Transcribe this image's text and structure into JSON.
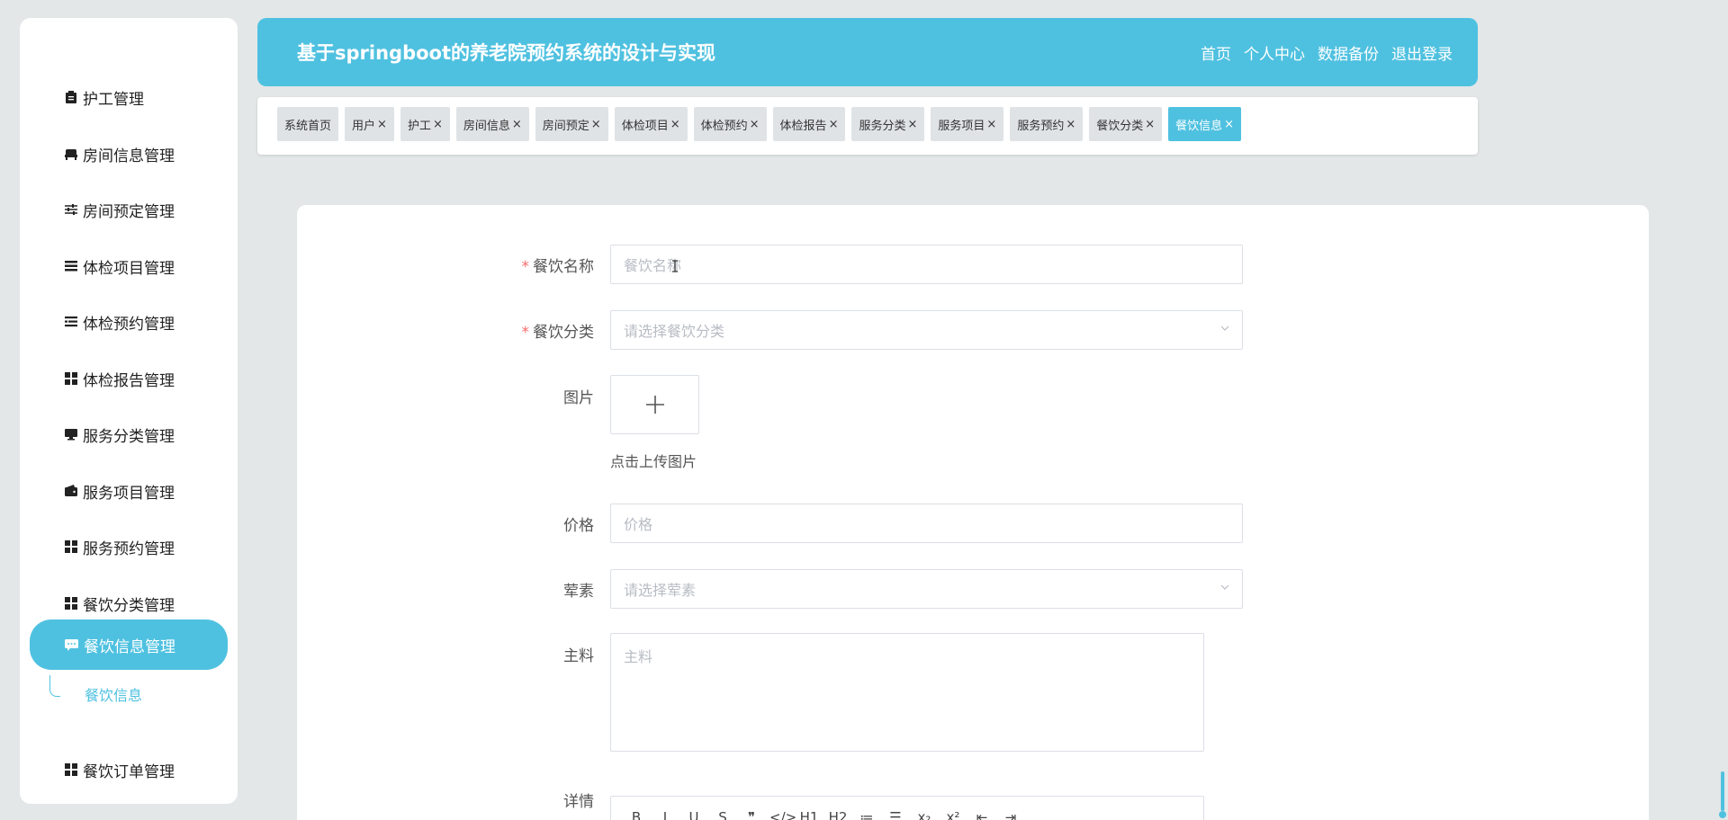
{
  "app": {
    "title": "基于springboot的养老院预约系统的设计与实现",
    "accent_color": "#4fc1e0",
    "nav": [
      "首页",
      "个人中心",
      "数据备份",
      "退出登录"
    ]
  },
  "sidebar": {
    "items": [
      {
        "label": "护工管理",
        "icon": "clipboard-icon"
      },
      {
        "label": "房间信息管理",
        "icon": "bed-icon"
      },
      {
        "label": "房间预定管理",
        "icon": "sliders-icon"
      },
      {
        "label": "体检项目管理",
        "icon": "list-icon"
      },
      {
        "label": "体检预约管理",
        "icon": "list-detail-icon"
      },
      {
        "label": "体检报告管理",
        "icon": "grid-icon"
      },
      {
        "label": "服务分类管理",
        "icon": "monitor-icon"
      },
      {
        "label": "服务项目管理",
        "icon": "wallet-icon"
      },
      {
        "label": "服务预约管理",
        "icon": "grid-icon"
      },
      {
        "label": "餐饮分类管理",
        "icon": "grid-icon"
      }
    ],
    "active": {
      "label": "餐饮信息管理",
      "icon": "message-icon"
    },
    "active_sub": "餐饮信息",
    "after": {
      "label": "餐饮订单管理",
      "icon": "grid-icon"
    }
  },
  "tabs": [
    {
      "label": "系统首页",
      "closable": false
    },
    {
      "label": "用户",
      "closable": true
    },
    {
      "label": "护工",
      "closable": true
    },
    {
      "label": "房间信息",
      "closable": true
    },
    {
      "label": "房间预定",
      "closable": true
    },
    {
      "label": "体检项目",
      "closable": true
    },
    {
      "label": "体检预约",
      "closable": true
    },
    {
      "label": "体检报告",
      "closable": true
    },
    {
      "label": "服务分类",
      "closable": true
    },
    {
      "label": "服务项目",
      "closable": true
    },
    {
      "label": "服务预约",
      "closable": true
    },
    {
      "label": "餐饮分类",
      "closable": true
    },
    {
      "label": "餐饮信息",
      "closable": true,
      "active": true
    }
  ],
  "tab_close_glyph": "×",
  "form": {
    "name": {
      "label": "餐饮名称",
      "placeholder": "餐饮名称",
      "required": "*"
    },
    "category": {
      "label": "餐饮分类",
      "placeholder": "请选择餐饮分类",
      "required": "*"
    },
    "image": {
      "label": "图片",
      "hint": "点击上传图片"
    },
    "price": {
      "label": "价格",
      "placeholder": "价格"
    },
    "veg": {
      "label": "荤素",
      "placeholder": "请选择荤素"
    },
    "main": {
      "label": "主料",
      "placeholder": "主料"
    },
    "detail": {
      "label": "详情"
    }
  },
  "editor_toolbar": [
    "B",
    "I",
    "U",
    "S",
    "❞",
    "</>",
    "H1",
    "H2",
    "≔",
    "☰",
    "x₂",
    "x²",
    "⇤",
    "⇥"
  ]
}
